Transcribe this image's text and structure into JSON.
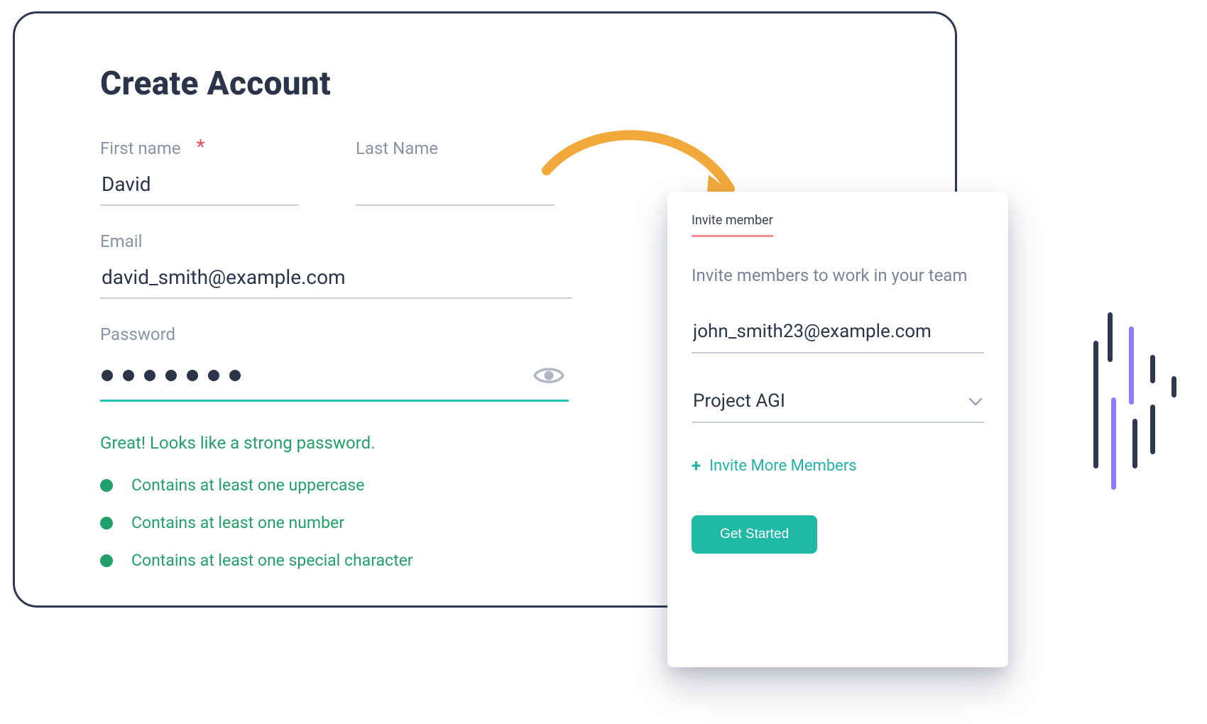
{
  "create": {
    "title": "Create Account",
    "first_name_label": "First name",
    "first_name_value": "David",
    "last_name_label": "Last Name",
    "last_name_value": "",
    "email_label": "Email",
    "email_value": "david_smith@example.com",
    "password_label": "Password",
    "password_dot_count": 7,
    "password_strength_msg": "Great! Looks like a strong password.",
    "password_rules": [
      "Contains at least one uppercase",
      "Contains at least one number",
      "Contains at least one special character"
    ]
  },
  "invite": {
    "tab_label": "Invite member",
    "heading": "Invite members to work in your team",
    "email_value": "john_smith23@example.com",
    "project_selected": "Project AGI",
    "invite_more_label": "Invite More Members",
    "cta_label": "Get Started"
  },
  "colors": {
    "accent_teal": "#1fb9a6",
    "success_green": "#22a06b",
    "arrow_orange": "#f2a93b",
    "tab_underline": "#f68f8f",
    "text_dark": "#2e3950"
  }
}
